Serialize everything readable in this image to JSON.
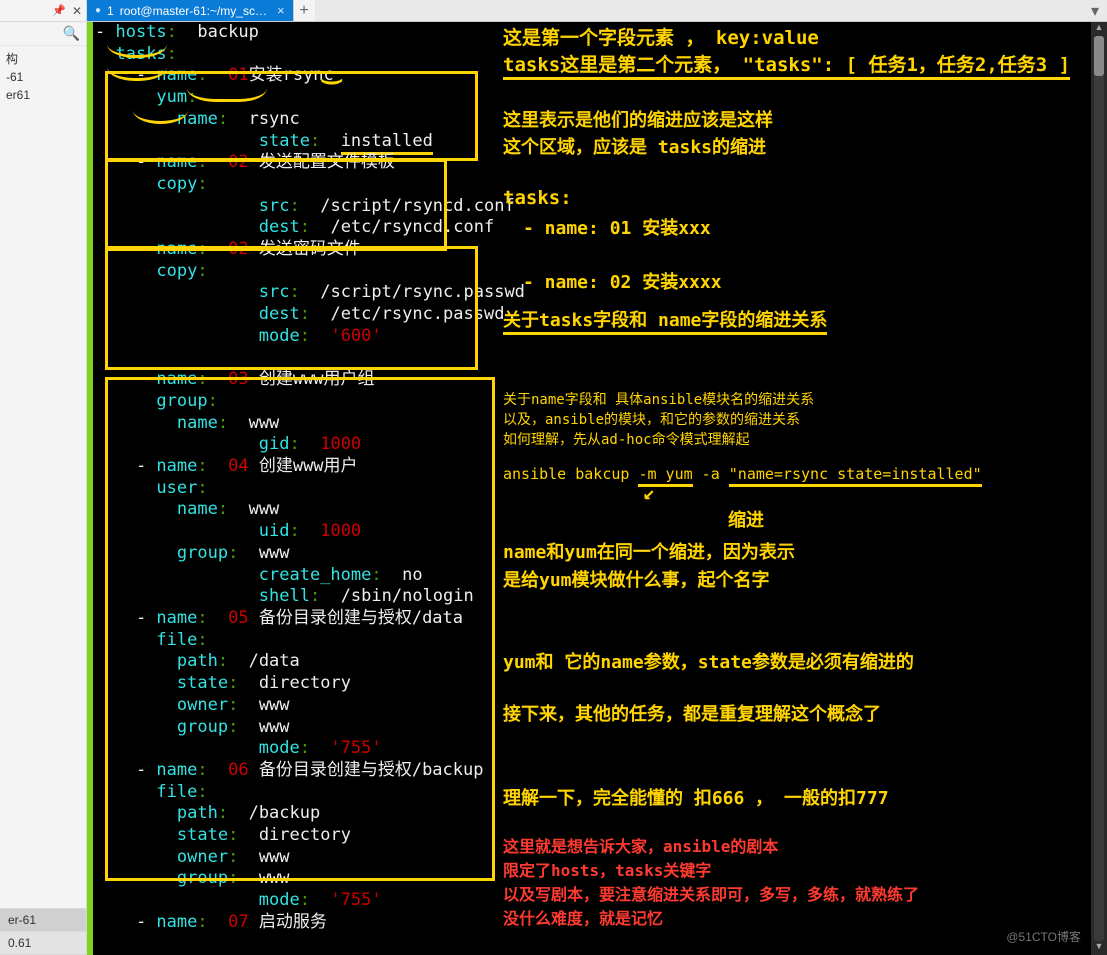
{
  "sidebar": {
    "tree": [
      "构",
      "-61",
      "er61"
    ],
    "bottom_tabs": [
      "er-61",
      "0.61"
    ]
  },
  "tab": {
    "index": "1",
    "title": "root@master-61:~/my_sc…"
  },
  "watermark": "@51CTO博客",
  "code": {
    "t1": "- hosts: backup",
    "l_hosts": "hosts",
    "l_backup": "backup",
    "l_tasks": "tasks",
    "n1_pre": "    - name: ",
    "n1_num": "01",
    "n1_txt": "安装rsync",
    "yum": "      yum",
    "yname": "        name:  rsync",
    "ystate_k": "        state",
    "ystate_v": "installed",
    "n2_pre": "    - name: ",
    "n2_num": "02",
    "n2_txt": " 发送配置文件模板",
    "copy1": "      copy",
    "src1_k": "        src",
    "src1_v": " /script/rsyncd.conf",
    "dst1_k": "        dest",
    "dst1_v": " /etc/rsyncd.conf",
    "n3_pre": "    - name: ",
    "n3_num": "02",
    "n3_txt": " 发送密码文件",
    "copy2": "      copy",
    "src2_k": "        src",
    "src2_v": " /script/rsync.passwd",
    "dst2_k": "        dest",
    "dst2_v": " /etc/rsync.passwd",
    "mode2_k": "        mode",
    "mode2_v": "'600'",
    "n4_pre": "    - name: ",
    "n4_num": "03",
    "n4_txt": " 创建www用户组",
    "group1": "      group",
    "gname": "        name:  www",
    "gid_k": "        gid",
    "gid_v": "1000",
    "n5_pre": "    - name: ",
    "n5_num": "04",
    "n5_txt": " 创建www用户",
    "user": "      user",
    "uname": "        name:  www",
    "uid_k": "        uid",
    "uid_v": "1000",
    "ugrp": "        group:  www",
    "uch_k": "        create_home",
    "uch_v": " no",
    "ush_k": "        shell",
    "ush_v": " /sbin/nologin",
    "n6_pre": "    - name: ",
    "n6_num": "05",
    "n6_txt": " 备份目录创建与授权/data",
    "file1": "      file",
    "fpath1": "        path:  /data",
    "fstate1": "        state:  directory",
    "fown1": "        owner:  www",
    "fgrp1": "        group:  www",
    "fmode1_k": "        mode",
    "fmode1_v": "'755'",
    "n7_pre": "    - name: ",
    "n7_num": "06",
    "n7_txt": " 备份目录创建与授权/backup",
    "file2": "      file",
    "fpath2": "        path:  /backup",
    "fstate2": "        state:  directory",
    "fown2": "        owner:  www",
    "fgrp2": "        group:  www",
    "fmode2_k": "        mode",
    "fmode2_v": "'755'",
    "n8_pre": "    - name: ",
    "n8_num": "07",
    "n8_txt": " 启动服务"
  },
  "ann": {
    "a1": "这是第一个字段元素   ，  key:value",
    "a2": "tasks这里是第二个元素，  \"tasks\":  [    任务1，任务2,任务3    ]",
    "a3": "这里表示是他们的缩进应该是这样",
    "a4": "这个区域，应该是 tasks的缩进",
    "a5": "tasks:",
    "a6": "  - name: 01 安装xxx",
    "a7": "  - name:  02 安装xxxx",
    "a8": "关于tasks字段和 name字段的缩进关系",
    "b1": "关于name字段和 具体ansible模块名的缩进关系",
    "b2": "以及，ansible的模块，和它的参数的缩进关系",
    "b3": "如何理解，先从ad-hoc命令模式理解起",
    "cmd_pre": "ansible bakcup ",
    "cmd_m": "-m yum",
    "cmd_a": " -a ",
    "cmd_q": "\"name=rsync  state=installed\"",
    "sj": "缩进",
    "c1": "name和yum在同一个缩进，因为表示",
    "c2": "是给yum模块做什么事，起个名字",
    "d1": "yum和 它的name参数，state参数是必须有缩进的",
    "d2": "接下来，其他的任务，都是重复理解这个概念了",
    "e1": "理解一下，完全能懂的 扣666 ， 一般的扣777",
    "r1": "这里就是想告诉大家，ansible的剧本",
    "r2": "限定了hosts，tasks关键字",
    "r3": "以及写剧本，要注意缩进关系即可，多写，多练，就熟练了",
    "r4": "没什么难度，就是记忆"
  }
}
